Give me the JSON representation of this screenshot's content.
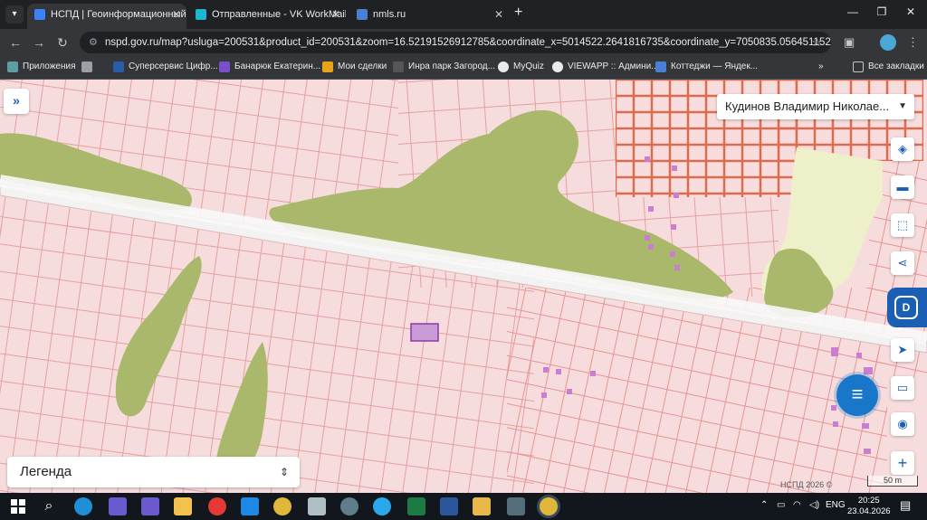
{
  "browser": {
    "tabs": [
      {
        "title": "НСПД | Геоинформационный",
        "active": true,
        "favicon_color": "#3b82f6"
      },
      {
        "title": "Отправленные - VK WorkMail",
        "active": false,
        "favicon_color": "#1fb6d1"
      },
      {
        "title": "nmls.ru",
        "active": false,
        "favicon_color": "#4a7fd6"
      }
    ],
    "tab_close": "✕",
    "new_tab": "+",
    "window_controls": {
      "minimize": "—",
      "restore": "❐",
      "close": "✕"
    },
    "back": "←",
    "forward": "→",
    "reload": "↻",
    "url": "nspd.gov.ru/map?usluga=200531&product_id=200531&zoom=16.52191526912785&coordinate_x=5014522.2641816735&coordinate_y=7050835.056451152&base...",
    "bookmark_star": "☆",
    "extensions_icon": "puzzle-icon",
    "menu": "⋮"
  },
  "bookmarks": [
    {
      "label": "Приложения",
      "color": "#5f9ea0"
    },
    {
      "label": "",
      "color": "#9aa0a6"
    },
    {
      "label": "Суперсервис Цифр...",
      "color": "#2a5caa"
    },
    {
      "label": "Банарюк Екатерин...",
      "color": "#7b4fc9"
    },
    {
      "label": "Мои сделки",
      "color": "#e8a317"
    },
    {
      "label": "Инра парк Загород...",
      "color": "#555555"
    },
    {
      "label": "MyQuiz",
      "color": "#e8eaed"
    },
    {
      "label": "VIEWAPP :: Админи...",
      "color": "#e8eaed"
    },
    {
      "label": "Коттеджи — Яндек...",
      "color": "#4a7fd6"
    }
  ],
  "bookmarks_more": "»",
  "all_bookmarks": "Все закладки",
  "map": {
    "user_name": "Кудинов Владимир Николае...",
    "legend_label": "Легенда",
    "copyright": "НСПД 2026 ©",
    "scale_label": "50 m",
    "colors": {
      "background": "#f6dcdc",
      "parcel_line": "#e8a3a3",
      "dense_parcel_line": "#e0785c",
      "forest": "#a9b86a",
      "road": "#f2f2f2",
      "selected_parcel": "#c89ad8",
      "building": "#c87fd0"
    },
    "tools": [
      "layers-icon",
      "ruler-icon",
      "area-select-icon",
      "share-icon",
      "navigate-icon",
      "snapshot-icon",
      "location-pin-icon",
      "zoom-in-icon"
    ]
  },
  "taskbar": {
    "apps": [
      "search-icon",
      "edge-icon",
      "save-icon",
      "save-icon",
      "folder-icon",
      "yandex-icon",
      "calendar-icon",
      "chrome-icon",
      "scanner-icon",
      "recovery-icon",
      "telegram-icon",
      "excel-icon",
      "word-icon",
      "paint-icon",
      "calculator-icon",
      "chrome-icon"
    ],
    "lang": "ENG",
    "time": "20:25",
    "date": "23.04.2026"
  }
}
